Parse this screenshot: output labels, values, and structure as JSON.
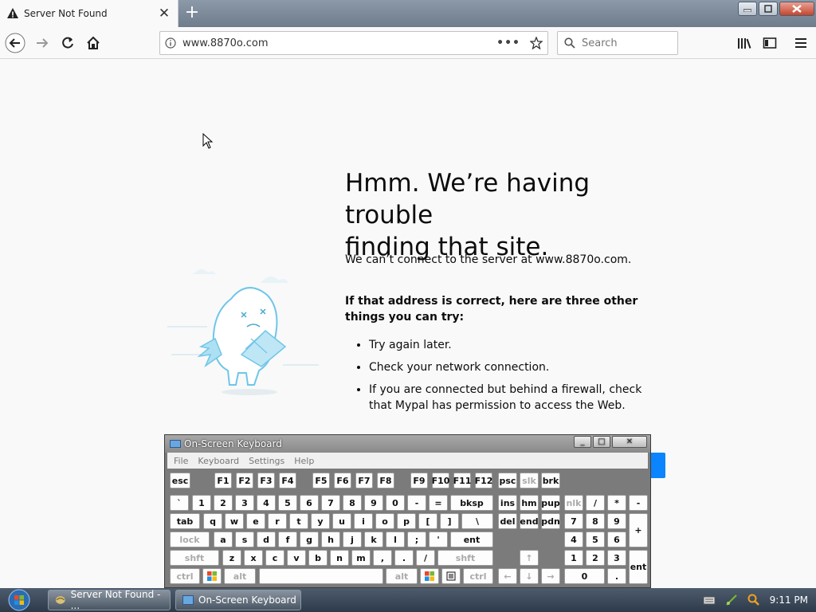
{
  "browser": {
    "tab_title": "Server Not Found",
    "url": "www.8870o.com",
    "url_more": "•••",
    "search_placeholder": "Search"
  },
  "page": {
    "title_line1": "Hmm. We’re having trouble",
    "title_line2": "finding that site.",
    "description": "We can’t connect to the server at www.8870o.com.",
    "suggestion_heading": "If that address is correct, here are three other things you can try:",
    "suggestions": [
      "Try again later.",
      "Check your network connection.",
      "If you are connected but behind a firewall, check that Mypal has permission to access the Web."
    ]
  },
  "osk": {
    "title": "On-Screen Keyboard",
    "menu": [
      "File",
      "Keyboard",
      "Settings",
      "Help"
    ],
    "rows": {
      "r1": [
        "esc",
        "F1",
        "F2",
        "F3",
        "F4",
        "F5",
        "F6",
        "F7",
        "F8",
        "F9",
        "F10",
        "F11",
        "F12",
        "psc",
        "slk",
        "brk"
      ],
      "r2": [
        "`",
        "1",
        "2",
        "3",
        "4",
        "5",
        "6",
        "7",
        "8",
        "9",
        "0",
        "-",
        "=",
        "bksp",
        "ins",
        "hm",
        "pup",
        "nlk",
        "/",
        "*",
        "-"
      ],
      "r3": [
        "tab",
        "q",
        "w",
        "e",
        "r",
        "t",
        "y",
        "u",
        "i",
        "o",
        "p",
        "[",
        "]",
        "\\",
        "del",
        "end",
        "pdn",
        "7",
        "8",
        "9",
        "+"
      ],
      "r4": [
        "lock",
        "a",
        "s",
        "d",
        "f",
        "g",
        "h",
        "j",
        "k",
        "l",
        ";",
        "'",
        "ent",
        "4",
        "5",
        "6"
      ],
      "r5": [
        "shft",
        "z",
        "x",
        "c",
        "v",
        "b",
        "n",
        "m",
        ",",
        ".",
        "/",
        "shft",
        "↑",
        "1",
        "2",
        "3",
        "ent"
      ],
      "r6": [
        "ctrl",
        "alt",
        "alt",
        "ctrl",
        "←",
        "↓",
        "→",
        "0",
        "."
      ]
    }
  },
  "taskbar": {
    "tasks": [
      "Server Not Found - ...",
      "On-Screen Keyboard"
    ],
    "clock": "9:11 PM"
  },
  "colors": {
    "accent_blue": "#0a84ff",
    "illustration": "#6fc6e8"
  }
}
